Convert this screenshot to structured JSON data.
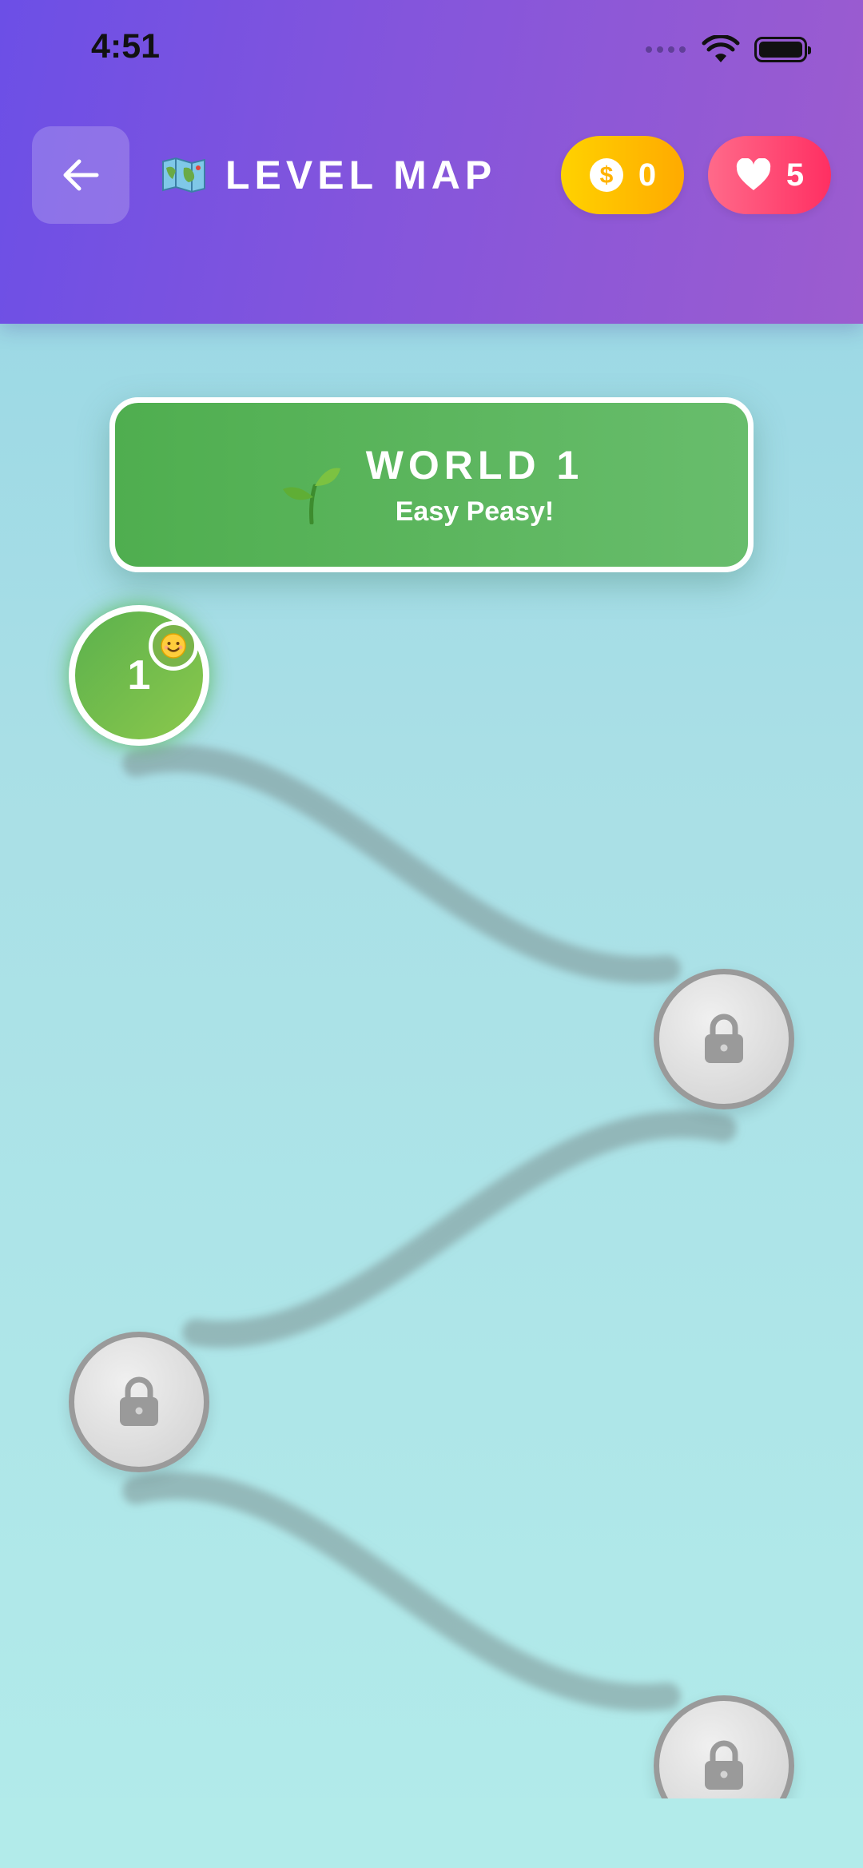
{
  "status_bar": {
    "time": "4:51"
  },
  "header": {
    "title": "LEVEL MAP",
    "coins": "0",
    "lives": "5"
  },
  "world": {
    "title": "WORLD 1",
    "subtitle": "Easy Peasy!"
  },
  "levels": [
    {
      "number": "1",
      "state": "unlocked"
    },
    {
      "state": "locked"
    },
    {
      "state": "locked"
    },
    {
      "state": "locked"
    }
  ],
  "colors": {
    "header_start": "#6c4fe6",
    "header_end": "#9c5ccf",
    "coin": "#ffbe00",
    "lives": "#ff3c68",
    "world_banner": "#5cb55e",
    "locked_node": "#d9d9d9"
  },
  "icons": [
    "back-arrow-icon",
    "map-icon",
    "coin-icon",
    "heart-icon",
    "sprout-icon",
    "smiley-face-icon",
    "lock-icon",
    "wifi-icon",
    "battery-icon"
  ]
}
